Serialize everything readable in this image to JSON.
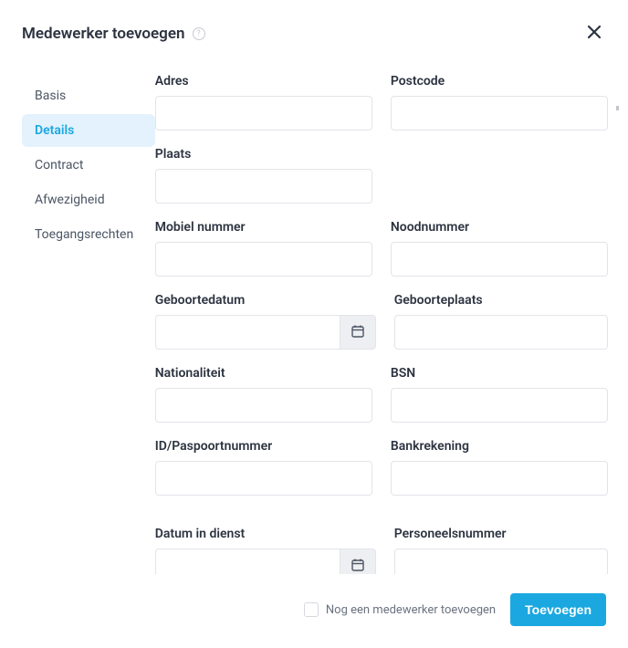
{
  "header": {
    "title": "Medewerker toevoegen"
  },
  "sidebar": {
    "items": [
      {
        "label": "Basis",
        "active": false
      },
      {
        "label": "Details",
        "active": true
      },
      {
        "label": "Contract",
        "active": false
      },
      {
        "label": "Afwezigheid",
        "active": false
      },
      {
        "label": "Toegangsrechten",
        "active": false
      }
    ]
  },
  "form": {
    "adres": {
      "label": "Adres",
      "value": ""
    },
    "postcode": {
      "label": "Postcode",
      "value": ""
    },
    "plaats": {
      "label": "Plaats",
      "value": ""
    },
    "mobiel": {
      "label": "Mobiel nummer",
      "value": ""
    },
    "nood": {
      "label": "Noodnummer",
      "value": ""
    },
    "geboortedatum": {
      "label": "Geboortedatum",
      "value": ""
    },
    "geboorteplaats": {
      "label": "Geboorteplaats",
      "value": ""
    },
    "nationaliteit": {
      "label": "Nationaliteit",
      "value": ""
    },
    "bsn": {
      "label": "BSN",
      "value": ""
    },
    "idpaspoort": {
      "label": "ID/Paspoortnummer",
      "value": ""
    },
    "bankrekening": {
      "label": "Bankrekening",
      "value": ""
    },
    "datum_dienst": {
      "label": "Datum in dienst",
      "value": ""
    },
    "personeelsnr": {
      "label": "Personeelsnummer",
      "value": ""
    }
  },
  "footer": {
    "another_label": "Nog een medewerker toevoegen",
    "submit_label": "Toevoegen"
  }
}
